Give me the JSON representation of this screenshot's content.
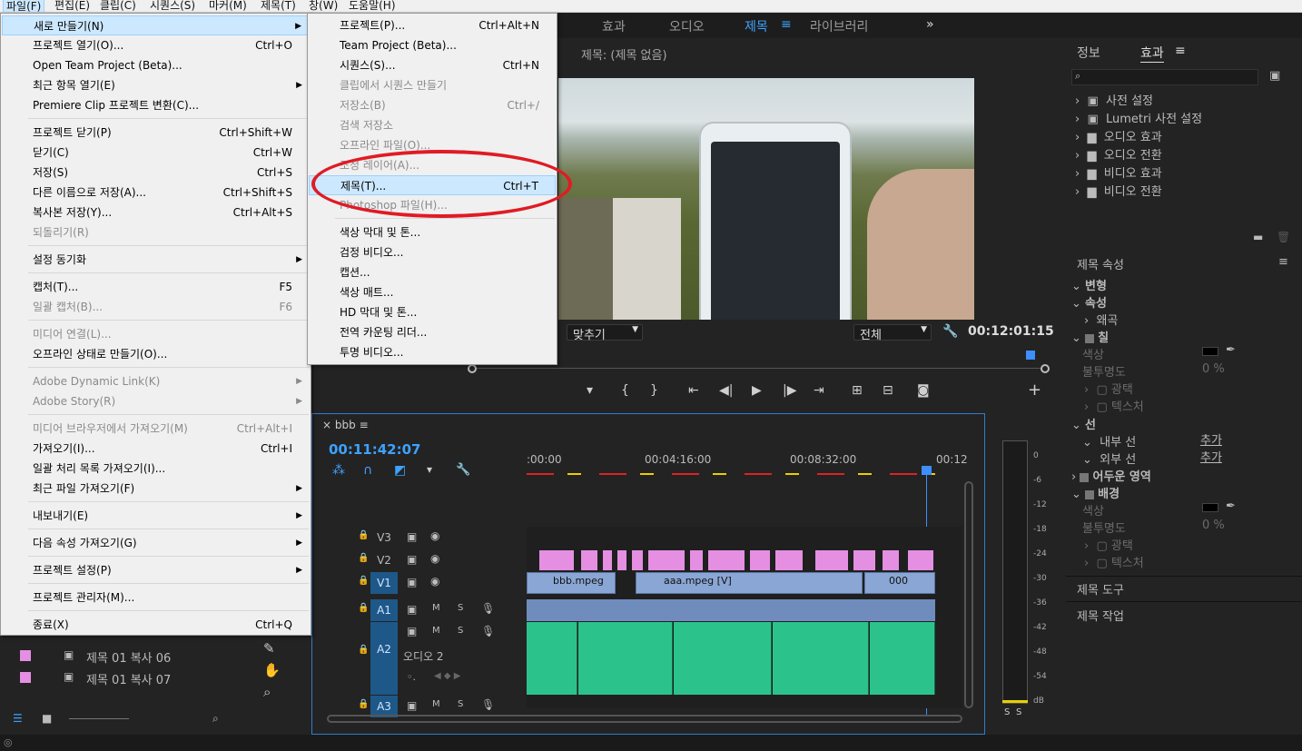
{
  "menubar": [
    "파일(F)",
    "편집(E)",
    "클립(C)",
    "시퀀스(S)",
    "마커(M)",
    "제목(T)",
    "창(W)",
    "도움말(H)"
  ],
  "workspace_tabs": [
    "효과",
    "오디오",
    "제목",
    "라이브러리"
  ],
  "workspace_more": "»",
  "program": {
    "title_label": "제목: (제목 없음)",
    "fit": "맞추기",
    "quality": "전체",
    "timecode": "00:12:01:15"
  },
  "file_menu": [
    {
      "label": "새로 만들기(N)",
      "shortcut": "",
      "arrow": true,
      "state": "hl"
    },
    {
      "label": "프로젝트 열기(O)...",
      "shortcut": "Ctrl+O"
    },
    {
      "label": "Open Team Project (Beta)...",
      "shortcut": ""
    },
    {
      "label": "최근 항목 열기(E)",
      "shortcut": "",
      "arrow": true
    },
    {
      "label": "Premiere Clip 프로젝트 변환(C)...",
      "shortcut": ""
    },
    {
      "label": "프로젝트 닫기(P)",
      "shortcut": "Ctrl+Shift+W"
    },
    {
      "label": "닫기(C)",
      "shortcut": "Ctrl+W"
    },
    {
      "label": "저장(S)",
      "shortcut": "Ctrl+S"
    },
    {
      "label": "다른 이름으로 저장(A)...",
      "shortcut": "Ctrl+Shift+S"
    },
    {
      "label": "복사본 저장(Y)...",
      "shortcut": "Ctrl+Alt+S"
    },
    {
      "label": "되돌리기(R)",
      "shortcut": "",
      "state": "dis"
    },
    {
      "label": "설정 동기화",
      "shortcut": "",
      "arrow": true
    },
    {
      "label": "캡처(T)...",
      "shortcut": "F5"
    },
    {
      "label": "일괄 캡처(B)...",
      "shortcut": "F6",
      "state": "dis"
    },
    {
      "label": "미디어 연결(L)...",
      "shortcut": "",
      "state": "dis"
    },
    {
      "label": "오프라인 상태로 만들기(O)...",
      "shortcut": ""
    },
    {
      "label": "Adobe Dynamic Link(K)",
      "shortcut": "",
      "arrow": true,
      "state": "dis"
    },
    {
      "label": "Adobe Story(R)",
      "shortcut": "",
      "arrow": true,
      "state": "dis"
    },
    {
      "label": "미디어 브라우저에서 가져오기(M)",
      "shortcut": "Ctrl+Alt+I",
      "state": "dis"
    },
    {
      "label": "가져오기(I)...",
      "shortcut": "Ctrl+I"
    },
    {
      "label": "일괄 처리 목록 가져오기(I)...",
      "shortcut": ""
    },
    {
      "label": "최근 파일 가져오기(F)",
      "shortcut": "",
      "arrow": true
    },
    {
      "label": "내보내기(E)",
      "shortcut": "",
      "arrow": true
    },
    {
      "label": "다음 속성 가져오기(G)",
      "shortcut": "",
      "arrow": true
    },
    {
      "label": "프로젝트 설정(P)",
      "shortcut": "",
      "arrow": true
    },
    {
      "label": "프로젝트 관리자(M)...",
      "shortcut": ""
    },
    {
      "label": "종료(X)",
      "shortcut": "Ctrl+Q"
    }
  ],
  "new_submenu": [
    {
      "label": "프로젝트(P)...",
      "shortcut": "Ctrl+Alt+N"
    },
    {
      "label": "Team Project (Beta)...",
      "shortcut": ""
    },
    {
      "label": "시퀀스(S)...",
      "shortcut": "Ctrl+N"
    },
    {
      "label": "클립에서 시퀀스 만들기",
      "shortcut": "",
      "state": "dis"
    },
    {
      "label": "저장소(B)",
      "shortcut": "Ctrl+/",
      "state": "dis"
    },
    {
      "label": "검색 저장소",
      "shortcut": "",
      "state": "dis"
    },
    {
      "label": "오프라인 파일(O)...",
      "shortcut": "",
      "state": "dis"
    },
    {
      "label": "조정 레이어(A)...",
      "shortcut": "",
      "state": "dis"
    },
    {
      "label": "제목(T)...",
      "shortcut": "Ctrl+T",
      "state": "hl"
    },
    {
      "label": "Photoshop 파일(H)...",
      "shortcut": "",
      "state": "dis"
    },
    {
      "label": "색상 막대 및 톤...",
      "shortcut": ""
    },
    {
      "label": "검정 비디오...",
      "shortcut": ""
    },
    {
      "label": "캡션...",
      "shortcut": ""
    },
    {
      "label": "색상 매트...",
      "shortcut": ""
    },
    {
      "label": "HD 막대 및 톤...",
      "shortcut": ""
    },
    {
      "label": "전역 카운팅 리더...",
      "shortcut": ""
    },
    {
      "label": "투명 비디오...",
      "shortcut": ""
    }
  ],
  "timeline": {
    "tab": "bbb",
    "timecode": "00:11:42:07",
    "ruler": [
      ":00:00",
      "00:04:16:00",
      "00:08:32:00",
      "00:12"
    ],
    "tracks": [
      "V3",
      "V2",
      "V1",
      "A1",
      "A2",
      "A3"
    ],
    "a2_name": "오디오 2",
    "clips": {
      "bbb": "bbb.mpeg",
      "aaa": "aaa.mpeg [V]",
      "c3": "000"
    }
  },
  "meters": {
    "scale": [
      "0",
      "-6",
      "-12",
      "-18",
      "-24",
      "-30",
      "-36",
      "-42",
      "-48",
      "-54",
      "dB"
    ],
    "solo": [
      "S",
      "S"
    ]
  },
  "effects_panel": {
    "tabs": [
      "정보",
      "효과"
    ],
    "items": [
      "사전 설정",
      "Lumetri 사전 설정",
      "오디오 효과",
      "오디오 전환",
      "비디오 효과",
      "비디오 전환"
    ]
  },
  "title_props": {
    "header": "제목 속성",
    "rows": [
      "변형",
      "속성",
      "왜곡",
      "칠",
      "색상",
      "불투명도",
      "0 %",
      "광택",
      "텍스처",
      "선",
      "내부 선",
      "추가",
      "외부 선",
      "추가",
      "어두운 영역",
      "배경",
      "색상",
      "불투명도",
      "0 %",
      "광택",
      "텍스처"
    ],
    "footer": [
      "제목 도구",
      "제목 작업"
    ]
  },
  "bin_items": [
    "제목 01 복사 06",
    "제목 01 복사 07"
  ]
}
